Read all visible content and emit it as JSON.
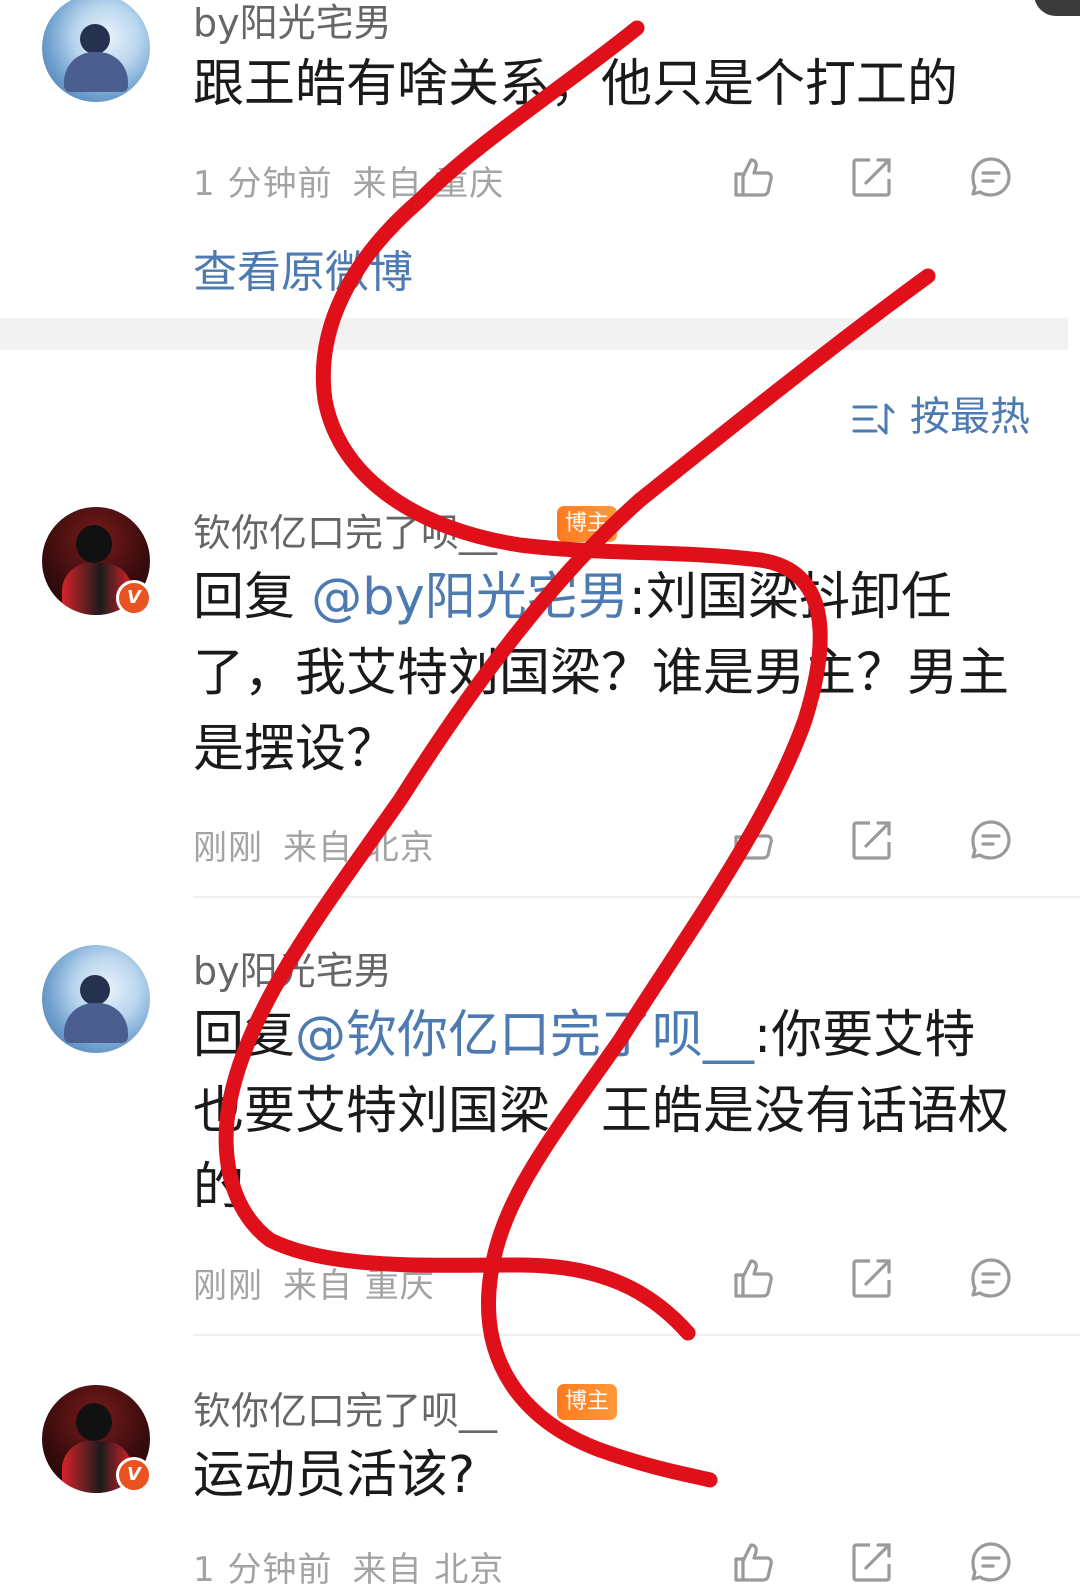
{
  "top_comment": {
    "username": "by阳光宅男",
    "text": "跟王皓有啥关系，他只是个打工的",
    "time": "1 分钟前",
    "location": "来自 重庆",
    "view_original": "查看原微博"
  },
  "sort": {
    "label": "按最热"
  },
  "comments": [
    {
      "username": "钦你亿口完了呗__",
      "badge": "博主",
      "reply_prefix": "回复 ",
      "mention": "@by阳光宅男",
      "text": ":刘国梁抖卸任了，我艾特刘国梁？谁是男主？男主是摆设？",
      "time": "刚刚",
      "location": "来自 北京"
    },
    {
      "username": "by阳光宅男",
      "reply_prefix": "回复",
      "mention": "@钦你亿口完了呗__",
      "text": ":你要艾特也要艾特刘国梁，王皓是没有话语权的",
      "time": "刚刚",
      "location": "来自 重庆"
    },
    {
      "username": "钦你亿口完了呗__",
      "badge": "博主",
      "text": "运动员活该?",
      "time": "1 分钟前",
      "location": "来自 北京"
    }
  ],
  "colors": {
    "link_blue": "#4d7bb1",
    "meta_gray": "#a3a3a3",
    "badge_orange": "#ff8a2a",
    "scribble_red": "#e0101a"
  },
  "icons": [
    "like-icon",
    "share-icon",
    "comment-icon",
    "sort-icon",
    "verified-badge-icon"
  ]
}
